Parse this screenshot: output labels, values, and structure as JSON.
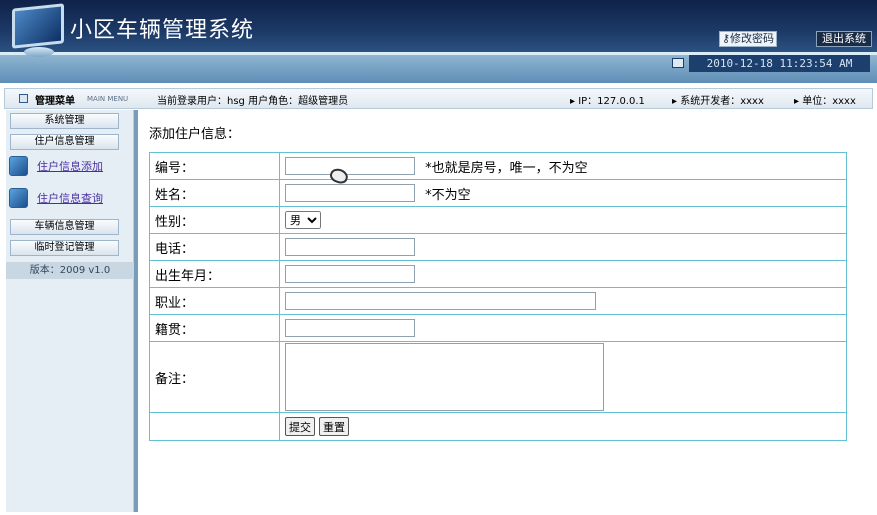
{
  "header": {
    "app_title": "小区车辆管理系统",
    "change_password_label": "修改密码",
    "logout_label": "退出系统",
    "datetime": "2010-12-18 11:23:54 AM"
  },
  "infobar": {
    "menu_title": "管理菜单",
    "menu_sub": "MAIN MENU",
    "current_user": "当前登录用户：hsg  用户角色：超级管理员",
    "ip": "▸ IP：127.0.0.1",
    "developer": "▸ 系统开发者：xxxx",
    "unit": "▸ 单位：xxxx"
  },
  "sidebar": {
    "system_mgmt": "系统管理",
    "resident_mgmt": "住户信息管理",
    "add_resident": "住户信息添加",
    "query_resident": "住户信息查询",
    "vehicle_mgmt": "车辆信息管理",
    "temp_register": "临时登记管理",
    "version": "版本：2009 v1.0"
  },
  "form": {
    "title": "添加住户信息：",
    "fields": {
      "number_label": "编号：",
      "number_hint": "*也就是房号，唯一，不为空",
      "name_label": "姓名：",
      "name_hint": "*不为空",
      "gender_label": "性别：",
      "gender_value": "男",
      "phone_label": "电话：",
      "birth_label": "出生年月：",
      "job_label": "职业：",
      "origin_label": "籍贯：",
      "remark_label": "备注："
    },
    "submit_label": "提交",
    "reset_label": "重置"
  },
  "colors": {
    "header_dark": "#142a52",
    "table_border": "#65c0d4",
    "link": "#4a2fa0"
  }
}
